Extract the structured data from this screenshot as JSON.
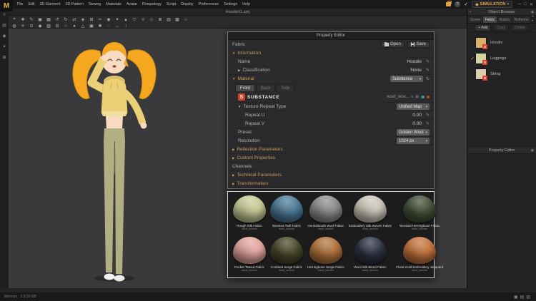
{
  "app": {
    "logo_letter": "M",
    "file_tab": "Hoodie01.zprj"
  },
  "menubar": {
    "items": [
      "File",
      "Edit",
      "3D Garment",
      "2D Pattern",
      "Sewing",
      "Materials",
      "Avatar",
      "Retopology",
      "Script",
      "Display",
      "Preferences",
      "Settings",
      "Help"
    ]
  },
  "top_right": {
    "help_glyph": "?",
    "check_glyph": "✓",
    "simulation_label": "SIMULATION",
    "sim_diamond": "◆",
    "caret": "▾",
    "window_controls": [
      "─",
      "□",
      "✕"
    ]
  },
  "left_rail": {
    "icons": [
      "≡",
      "▤",
      "◉",
      "✦",
      "⊞"
    ]
  },
  "toolbar": {
    "row1": [
      "⌖",
      "✚",
      "✎",
      "▣",
      "▦",
      "↺",
      "↻",
      "⇄",
      "◈",
      "⊞",
      "✂",
      "◉",
      "✦",
      "▲",
      "▽",
      "≡",
      "◇",
      "⊠",
      "▤",
      "▩",
      "⌂"
    ],
    "row2": [
      "◍",
      "✛",
      "⊙",
      "◆",
      "▧",
      "⊟",
      "○",
      "●",
      "△",
      "▣",
      "✱",
      "◌",
      "↔",
      "↕"
    ]
  },
  "object_browser": {
    "title": "Object Browser",
    "dot": "▪",
    "pin": "◉",
    "tabs": [
      "Scene",
      "Fabric",
      "Button",
      "Buttonho"
    ],
    "tab_arrows": "◂ ▸",
    "add_button": "+ Add",
    "copy_button": "Copy",
    "delete_button": "Delete",
    "badge": "S",
    "check_glyph": "✓",
    "items": [
      {
        "name": "Hoodie",
        "color": "#d9b06a",
        "checked": false
      },
      {
        "name": "Leggings",
        "color": "#d6d3a2",
        "checked": true
      },
      {
        "name": "String",
        "color": "#dccdb0",
        "checked": false
      }
    ]
  },
  "secondary_panel": {
    "title": "Property Editor"
  },
  "property_editor": {
    "title": "Property Editor",
    "fabric_label": "Fabric",
    "open_button": "Open",
    "save_button": "Save",
    "information_header": "Information",
    "name_label": "Name",
    "name_value": "Hoodie",
    "classification_label": "Classification",
    "classification_value": "None",
    "material_header": "Material",
    "material_value": "Substance",
    "material_tabs": [
      "Front",
      "Back",
      "Side"
    ],
    "substance_brand": "SUBSTANCE",
    "substance_file": "wool_wov...",
    "texture_repeat_label": "Texture Repeat Type",
    "texture_repeat_value": "Unified Map",
    "repeat_u_label": "Repeat U",
    "repeat_u_value": "0.00",
    "repeat_v_label": "Repeat V",
    "repeat_v_value": "0.00",
    "preset_label": "Preset",
    "preset_value": "Golden Wool",
    "resolution_label": "Resolution",
    "resolution_value": "1024 px",
    "reflection_header": "Reflection Parameters",
    "custom_header": "Custom Properties",
    "channels_label": "Channels",
    "technical_header": "Technical Parameters",
    "transformation_header": "Transformation"
  },
  "gallery": {
    "swatches": [
      {
        "name": "Rough Silk Fabric",
        "sub": "wool_woven",
        "color": "#c9cd98"
      },
      {
        "name": "Worsted Twill Fabric",
        "sub": "wool_woven",
        "color": "#4e7c9a"
      },
      {
        "name": "Houndstooth Wool Fabric",
        "sub": "wool_woven",
        "color": "#8f8f8d"
      },
      {
        "name": "Embroidery Silk Woven Fabric",
        "sub": "wool_woven",
        "color": "#cec8ba"
      },
      {
        "name": "Worsted Herringbone Fabric",
        "sub": "wool_woven",
        "color": "#45523a"
      },
      {
        "name": "Pocket Tweed Fabric",
        "sub": "wool_woven",
        "color": "#e6a8a1"
      },
      {
        "name": "Combed Serge Fabric",
        "sub": "wool_woven",
        "color": "#4c4a2c"
      },
      {
        "name": "Herringbone Serge Fabric",
        "sub": "wool_woven",
        "color": "#b4763c"
      },
      {
        "name": "Wool Silk Blend Fabric",
        "sub": "wool_woven",
        "color": "#2f3544"
      },
      {
        "name": "Floral Gold Embroidery Jacquard",
        "sub": "wool_woven",
        "color": "#c8763e"
      }
    ]
  },
  "statusbar": {
    "memory": "Memory : 3.2/16 GB",
    "view_icons": [
      "▣",
      "▤",
      "▥"
    ]
  },
  "colors": {
    "accent_orange": "#e8a33d",
    "substance_red": "#d9402a",
    "section_tan": "#c79a57",
    "viewport_gray": "#3a3a3c",
    "hoodie_yellow": "#ead178",
    "leggings_khaki": "#b2b083",
    "hair_orange": "#f5a81f"
  }
}
